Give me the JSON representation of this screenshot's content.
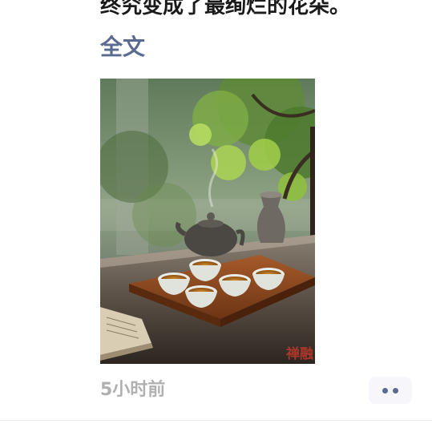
{
  "post": {
    "text_line": "终究变成了最绚烂的花朵。",
    "full_text_link": "全文",
    "image_watermark": "禅融",
    "timestamp": "5小时前"
  },
  "colors": {
    "link": "#5a6a91",
    "timestamp": "#b0b0b0",
    "text": "#1a1a1a"
  },
  "icons": {
    "more": "more-dots-icon"
  }
}
